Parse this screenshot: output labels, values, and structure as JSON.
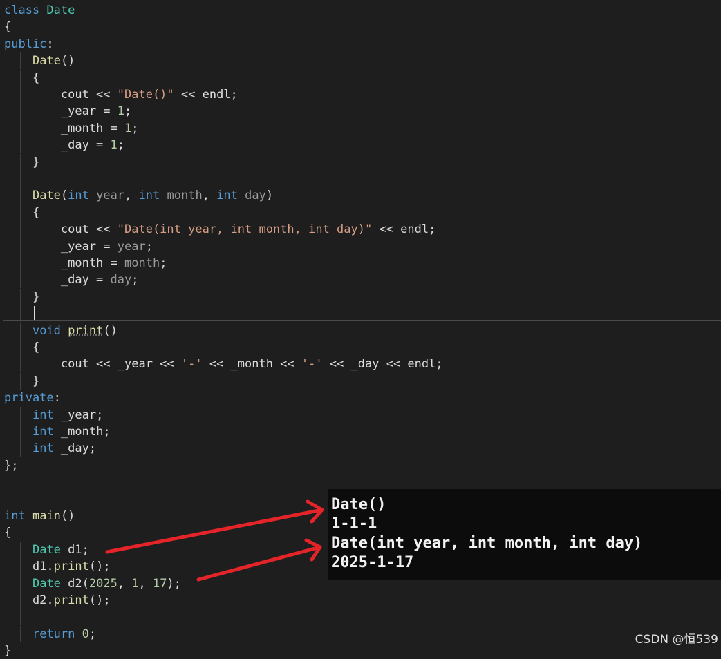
{
  "editor": {
    "indent_guides": [
      [],
      [],
      [],
      [
        1
      ],
      [
        1
      ],
      [
        1,
        2
      ],
      [
        1,
        2
      ],
      [
        1,
        2
      ],
      [
        1,
        2
      ],
      [
        1
      ],
      [
        1
      ],
      [
        1
      ],
      [
        1
      ],
      [
        1,
        2
      ],
      [
        1,
        2
      ],
      [
        1,
        2
      ],
      [
        1,
        2
      ],
      [
        1
      ],
      [
        1
      ],
      [
        1
      ],
      [
        1
      ],
      [
        1,
        2
      ],
      [
        1
      ],
      [],
      [
        1
      ],
      [
        1
      ],
      [
        1
      ],
      [],
      [],
      [],
      [],
      [],
      [
        1
      ],
      [
        1
      ],
      [
        1
      ],
      [
        1
      ],
      [
        1
      ],
      [
        1
      ],
      []
    ],
    "lines": [
      [
        [
          "kw",
          "class "
        ],
        [
          "type",
          "Date"
        ]
      ],
      [
        [
          "plain",
          "{"
        ]
      ],
      [
        [
          "kw",
          "public"
        ],
        [
          "plain",
          ":"
        ]
      ],
      [
        [
          "plain",
          "    "
        ],
        [
          "fn",
          "Date"
        ],
        [
          "plain",
          "()"
        ]
      ],
      [
        [
          "plain",
          "    {"
        ]
      ],
      [
        [
          "plain",
          "        cout << "
        ],
        [
          "str",
          "\"Date()\""
        ],
        [
          "plain",
          " << endl;"
        ]
      ],
      [
        [
          "plain",
          "        _year = "
        ],
        [
          "num",
          "1"
        ],
        [
          "plain",
          ";"
        ]
      ],
      [
        [
          "plain",
          "        _month = "
        ],
        [
          "num",
          "1"
        ],
        [
          "plain",
          ";"
        ]
      ],
      [
        [
          "plain",
          "        _day = "
        ],
        [
          "num",
          "1"
        ],
        [
          "plain",
          ";"
        ]
      ],
      [
        [
          "plain",
          "    }"
        ]
      ],
      [],
      [
        [
          "plain",
          "    "
        ],
        [
          "fn",
          "Date"
        ],
        [
          "plain",
          "("
        ],
        [
          "kw",
          "int"
        ],
        [
          "param",
          " year"
        ],
        [
          "plain",
          ", "
        ],
        [
          "kw",
          "int"
        ],
        [
          "param",
          " month"
        ],
        [
          "plain",
          ", "
        ],
        [
          "kw",
          "int"
        ],
        [
          "param",
          " day"
        ],
        [
          "plain",
          ")"
        ]
      ],
      [
        [
          "plain",
          "    {"
        ]
      ],
      [
        [
          "plain",
          "        cout << "
        ],
        [
          "str",
          "\"Date(int year, int month, int day)\""
        ],
        [
          "plain",
          " << endl;"
        ]
      ],
      [
        [
          "plain",
          "        _year = "
        ],
        [
          "param",
          "year"
        ],
        [
          "plain",
          ";"
        ]
      ],
      [
        [
          "plain",
          "        _month = "
        ],
        [
          "param",
          "month"
        ],
        [
          "plain",
          ";"
        ]
      ],
      [
        [
          "plain",
          "        _day = "
        ],
        [
          "param",
          "day"
        ],
        [
          "plain",
          ";"
        ]
      ],
      [
        [
          "plain",
          "    }"
        ]
      ],
      [],
      [
        [
          "plain",
          "    "
        ],
        [
          "kw",
          "void"
        ],
        [
          "plain",
          " "
        ],
        [
          "fn-squig",
          "print"
        ],
        [
          "plain",
          "()"
        ]
      ],
      [
        [
          "plain",
          "    {"
        ]
      ],
      [
        [
          "plain",
          "        cout << _year << "
        ],
        [
          "str",
          "'-'"
        ],
        [
          "plain",
          " << _month << "
        ],
        [
          "str",
          "'-'"
        ],
        [
          "plain",
          " << _day << endl;"
        ]
      ],
      [
        [
          "plain",
          "    }"
        ]
      ],
      [
        [
          "kw",
          "private"
        ],
        [
          "plain",
          ":"
        ]
      ],
      [
        [
          "plain",
          "    "
        ],
        [
          "kw",
          "int"
        ],
        [
          "plain",
          " _year;"
        ]
      ],
      [
        [
          "plain",
          "    "
        ],
        [
          "kw",
          "int"
        ],
        [
          "plain",
          " _month;"
        ]
      ],
      [
        [
          "plain",
          "    "
        ],
        [
          "kw",
          "int"
        ],
        [
          "plain",
          " _day;"
        ]
      ],
      [
        [
          "plain",
          "};"
        ]
      ],
      [],
      [],
      [
        [
          "kw",
          "int"
        ],
        [
          "plain",
          " "
        ],
        [
          "fn",
          "main"
        ],
        [
          "plain",
          "()"
        ]
      ],
      [
        [
          "plain",
          "{"
        ]
      ],
      [
        [
          "plain",
          "    "
        ],
        [
          "type",
          "Date"
        ],
        [
          "plain",
          " d1;"
        ]
      ],
      [
        [
          "plain",
          "    d1."
        ],
        [
          "fn",
          "print"
        ],
        [
          "plain",
          "();"
        ]
      ],
      [
        [
          "plain",
          "    "
        ],
        [
          "type",
          "Date"
        ],
        [
          "plain",
          " d2("
        ],
        [
          "num",
          "2025"
        ],
        [
          "plain",
          ", "
        ],
        [
          "num",
          "1"
        ],
        [
          "plain",
          ", "
        ],
        [
          "num",
          "17"
        ],
        [
          "plain",
          ");"
        ]
      ],
      [
        [
          "plain",
          "    d2."
        ],
        [
          "fn",
          "print"
        ],
        [
          "plain",
          "();"
        ]
      ],
      [],
      [
        [
          "plain",
          "    "
        ],
        [
          "kw",
          "return"
        ],
        [
          "plain",
          " "
        ],
        [
          "num",
          "0"
        ],
        [
          "plain",
          ";"
        ]
      ],
      [
        [
          "plain",
          "}"
        ]
      ]
    ]
  },
  "console": {
    "lines": [
      "Date()",
      "1-1-1",
      "Date(int year, int month, int day)",
      "2025-1-17"
    ]
  },
  "colors": {
    "editor_bg": "#1e1e1e",
    "keyword": "#569cd6",
    "type": "#4ec9b0",
    "function": "#dcdcaa",
    "string": "#d69d85",
    "number": "#b5cea8",
    "console_bg": "#0c0c0c",
    "arrow": "#e5242a"
  },
  "watermark": "CSDN @恒539"
}
